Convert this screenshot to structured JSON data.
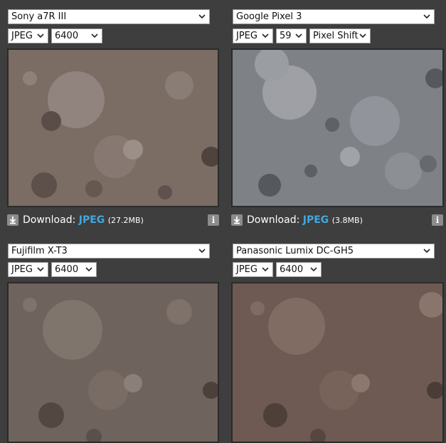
{
  "panels": [
    {
      "camera": "Sony a7R III",
      "format": "JPEG",
      "iso": "6400",
      "download": {
        "label": "Download:",
        "format": "JPEG",
        "size": "(27.2MB)"
      }
    },
    {
      "camera": "Google Pixel 3",
      "format": "JPEG",
      "iso": "59",
      "mode": "Pixel Shift",
      "download": {
        "label": "Download:",
        "format": "JPEG",
        "size": "(3.8MB)"
      }
    },
    {
      "camera": "Fujifilm X-T3",
      "format": "JPEG",
      "iso": "6400"
    },
    {
      "camera": "Panasonic Lumix DC-GH5",
      "format": "JPEG",
      "iso": "6400"
    }
  ],
  "icons": {
    "download": "download-icon",
    "info": "info-icon",
    "dropdown": "chevron-down-icon"
  },
  "colors": {
    "background": "#3e3e3e",
    "accent_format": "#3fa9e0",
    "sony_tint": "#7b6c64",
    "pixel_tint": "#7e8185",
    "fuji_tint": "#6f635d",
    "gh5_tint": "#6e5a52"
  }
}
